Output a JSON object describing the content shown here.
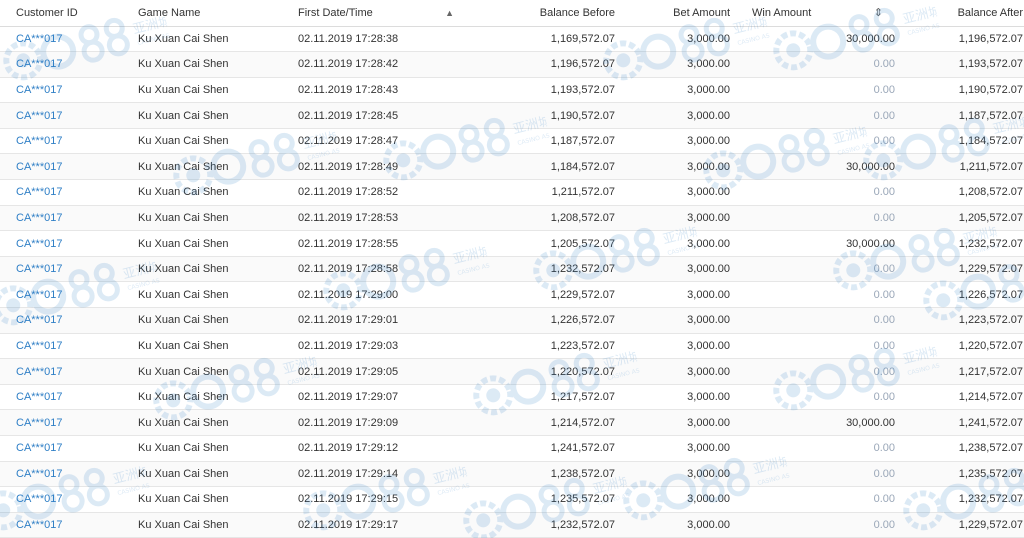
{
  "table": {
    "headers": {
      "customer_id": "Customer ID",
      "game_name": "Game Name",
      "first_date_time": "First Date/Time",
      "balance_before": "Balance Before",
      "bet_amount": "Bet Amount",
      "win_amount": "Win Amount",
      "balance_after": "Balance After"
    },
    "sort_icons": {
      "first_date_time": "sort-ascending-icon",
      "win_amount": "sortable-icon"
    },
    "rows": [
      {
        "customer_id": "CA***017",
        "game_name": "Ku Xuan Cai Shen",
        "date_time": "02.11.2019 17:28:38",
        "balance_before": "1,169,572.07",
        "bet_amount": "3,000.00",
        "win_amount": "30,000.00",
        "balance_after": "1,196,572.07"
      },
      {
        "customer_id": "CA***017",
        "game_name": "Ku Xuan Cai Shen",
        "date_time": "02.11.2019 17:28:42",
        "balance_before": "1,196,572.07",
        "bet_amount": "3,000.00",
        "win_amount": "0.00",
        "balance_after": "1,193,572.07"
      },
      {
        "customer_id": "CA***017",
        "game_name": "Ku Xuan Cai Shen",
        "date_time": "02.11.2019 17:28:43",
        "balance_before": "1,193,572.07",
        "bet_amount": "3,000.00",
        "win_amount": "0.00",
        "balance_after": "1,190,572.07"
      },
      {
        "customer_id": "CA***017",
        "game_name": "Ku Xuan Cai Shen",
        "date_time": "02.11.2019 17:28:45",
        "balance_before": "1,190,572.07",
        "bet_amount": "3,000.00",
        "win_amount": "0.00",
        "balance_after": "1,187,572.07"
      },
      {
        "customer_id": "CA***017",
        "game_name": "Ku Xuan Cai Shen",
        "date_time": "02.11.2019 17:28:47",
        "balance_before": "1,187,572.07",
        "bet_amount": "3,000.00",
        "win_amount": "0.00",
        "balance_after": "1,184,572.07"
      },
      {
        "customer_id": "CA***017",
        "game_name": "Ku Xuan Cai Shen",
        "date_time": "02.11.2019 17:28:49",
        "balance_before": "1,184,572.07",
        "bet_amount": "3,000.00",
        "win_amount": "30,000.00",
        "balance_after": "1,211,572.07"
      },
      {
        "customer_id": "CA***017",
        "game_name": "Ku Xuan Cai Shen",
        "date_time": "02.11.2019 17:28:52",
        "balance_before": "1,211,572.07",
        "bet_amount": "3,000.00",
        "win_amount": "0.00",
        "balance_after": "1,208,572.07"
      },
      {
        "customer_id": "CA***017",
        "game_name": "Ku Xuan Cai Shen",
        "date_time": "02.11.2019 17:28:53",
        "balance_before": "1,208,572.07",
        "bet_amount": "3,000.00",
        "win_amount": "0.00",
        "balance_after": "1,205,572.07"
      },
      {
        "customer_id": "CA***017",
        "game_name": "Ku Xuan Cai Shen",
        "date_time": "02.11.2019 17:28:55",
        "balance_before": "1,205,572.07",
        "bet_amount": "3,000.00",
        "win_amount": "30,000.00",
        "balance_after": "1,232,572.07"
      },
      {
        "customer_id": "CA***017",
        "game_name": "Ku Xuan Cai Shen",
        "date_time": "02.11.2019 17:28:58",
        "balance_before": "1,232,572.07",
        "bet_amount": "3,000.00",
        "win_amount": "0.00",
        "balance_after": "1,229,572.07"
      },
      {
        "customer_id": "CA***017",
        "game_name": "Ku Xuan Cai Shen",
        "date_time": "02.11.2019 17:29:00",
        "balance_before": "1,229,572.07",
        "bet_amount": "3,000.00",
        "win_amount": "0.00",
        "balance_after": "1,226,572.07"
      },
      {
        "customer_id": "CA***017",
        "game_name": "Ku Xuan Cai Shen",
        "date_time": "02.11.2019 17:29:01",
        "balance_before": "1,226,572.07",
        "bet_amount": "3,000.00",
        "win_amount": "0.00",
        "balance_after": "1,223,572.07"
      },
      {
        "customer_id": "CA***017",
        "game_name": "Ku Xuan Cai Shen",
        "date_time": "02.11.2019 17:29:03",
        "balance_before": "1,223,572.07",
        "bet_amount": "3,000.00",
        "win_amount": "0.00",
        "balance_after": "1,220,572.07"
      },
      {
        "customer_id": "CA***017",
        "game_name": "Ku Xuan Cai Shen",
        "date_time": "02.11.2019 17:29:05",
        "balance_before": "1,220,572.07",
        "bet_amount": "3,000.00",
        "win_amount": "0.00",
        "balance_after": "1,217,572.07"
      },
      {
        "customer_id": "CA***017",
        "game_name": "Ku Xuan Cai Shen",
        "date_time": "02.11.2019 17:29:07",
        "balance_before": "1,217,572.07",
        "bet_amount": "3,000.00",
        "win_amount": "0.00",
        "balance_after": "1,214,572.07"
      },
      {
        "customer_id": "CA***017",
        "game_name": "Ku Xuan Cai Shen",
        "date_time": "02.11.2019 17:29:09",
        "balance_before": "1,214,572.07",
        "bet_amount": "3,000.00",
        "win_amount": "30,000.00",
        "balance_after": "1,241,572.07"
      },
      {
        "customer_id": "CA***017",
        "game_name": "Ku Xuan Cai Shen",
        "date_time": "02.11.2019 17:29:12",
        "balance_before": "1,241,572.07",
        "bet_amount": "3,000.00",
        "win_amount": "0.00",
        "balance_after": "1,238,572.07"
      },
      {
        "customer_id": "CA***017",
        "game_name": "Ku Xuan Cai Shen",
        "date_time": "02.11.2019 17:29:14",
        "balance_before": "1,238,572.07",
        "bet_amount": "3,000.00",
        "win_amount": "0.00",
        "balance_after": "1,235,572.07"
      },
      {
        "customer_id": "CA***017",
        "game_name": "Ku Xuan Cai Shen",
        "date_time": "02.11.2019 17:29:15",
        "balance_before": "1,235,572.07",
        "bet_amount": "3,000.00",
        "win_amount": "0.00",
        "balance_after": "1,232,572.07"
      },
      {
        "customer_id": "CA***017",
        "game_name": "Ku Xuan Cai Shen",
        "date_time": "02.11.2019 17:29:17",
        "balance_before": "1,232,572.07",
        "bet_amount": "3,000.00",
        "win_amount": "0.00",
        "balance_after": "1,229,572.07"
      }
    ]
  },
  "colors": {
    "link": "#2f7fc6",
    "zero_value": "#9aa7b8",
    "watermark": "#2f7fc6"
  },
  "watermark": {
    "text": "CA88",
    "sub_text": "亚洲城",
    "tag": "CASINO ASIA"
  }
}
